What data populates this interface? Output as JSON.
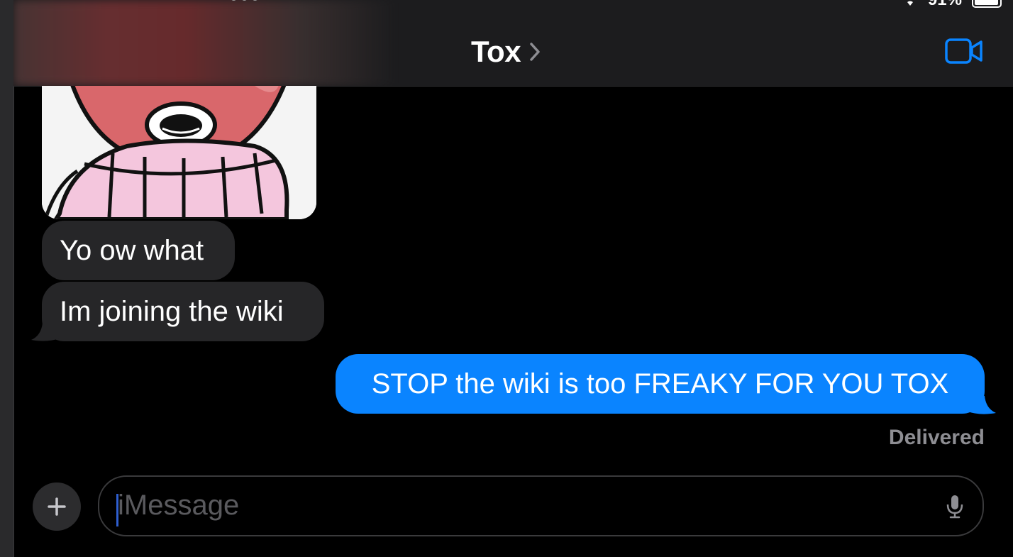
{
  "status_bar": {
    "battery": "91%"
  },
  "header": {
    "title": "Tox"
  },
  "messages": [
    {
      "direction": "incoming",
      "text": "Yo ow what"
    },
    {
      "direction": "incoming",
      "text": "Im joining the wiki"
    },
    {
      "direction": "outgoing",
      "text": "STOP the wiki is too FREAKY FOR YOU TOX"
    }
  ],
  "receipt": "Delivered",
  "composer": {
    "placeholder": "iMessage"
  },
  "colors": {
    "accent": "#0a84ff",
    "incoming_bubble": "#262628",
    "background": "#000000",
    "secondary_text": "#8e8e93"
  },
  "icons": [
    "more-dots-icon",
    "wifi-icon",
    "battery-icon",
    "chevron-right-icon",
    "video-camera-icon",
    "plus-icon",
    "microphone-icon"
  ]
}
